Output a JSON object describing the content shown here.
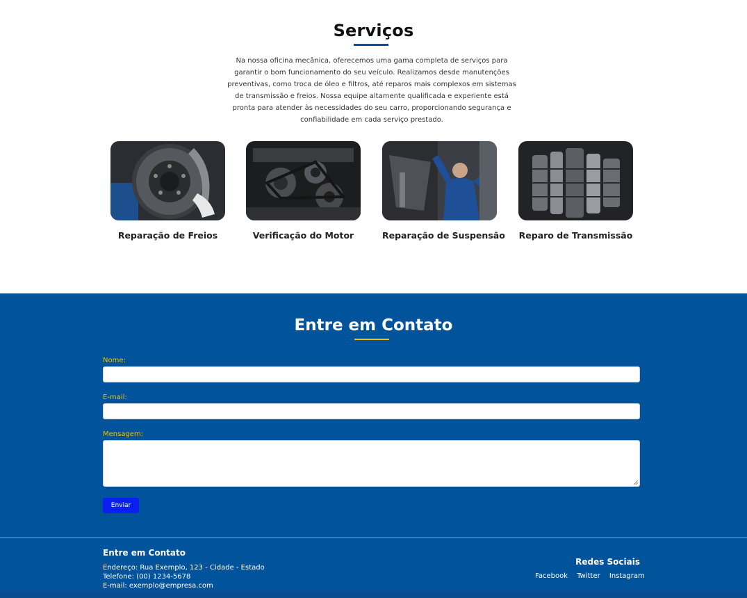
{
  "services": {
    "title": "Serviços",
    "description": "Na nossa oficina mecânica, oferecemos uma gama completa de serviços para garantir o bom funcionamento do seu veículo. Realizamos desde manutenções preventivas, como troca de óleo e filtros, até reparos mais complexos em sistemas de transmissão e freios. Nossa equipe altamente qualificada e experiente está pronta para atender às necessidades do seu carro, proporcionando segurança e confiabilidade em cada serviço prestado.",
    "cards": [
      {
        "label": "Reparação de Freios",
        "image": "brake-disc-photo"
      },
      {
        "label": "Verificação do Motor",
        "image": "engine-photo"
      },
      {
        "label": "Reparação de Suspensão",
        "image": "mechanic-suspension-photo"
      },
      {
        "label": "Reparo de Transmissão",
        "image": "transmission-gears-photo"
      }
    ]
  },
  "contact": {
    "title": "Entre em Contato",
    "name_label": "Nome:",
    "name_value": "",
    "email_label": "E-mail:",
    "email_value": "",
    "message_label": "Mensagem:",
    "message_value": "",
    "submit_label": "Enviar"
  },
  "footer": {
    "title": "Entre em Contato",
    "address": "Endereço: Rua Exemplo, 123 - Cidade - Estado",
    "phone": "Telefone: (00) 1234-5678",
    "email": "E-mail: exemplo@empresa.com",
    "social_title": "Redes Sociais",
    "social_links": [
      "Facebook",
      "Twitter",
      "Instagram"
    ]
  },
  "colors": {
    "brand_blue": "#01549c",
    "accent_yellow": "#f2c200",
    "button_blue": "#0a1ff0"
  }
}
